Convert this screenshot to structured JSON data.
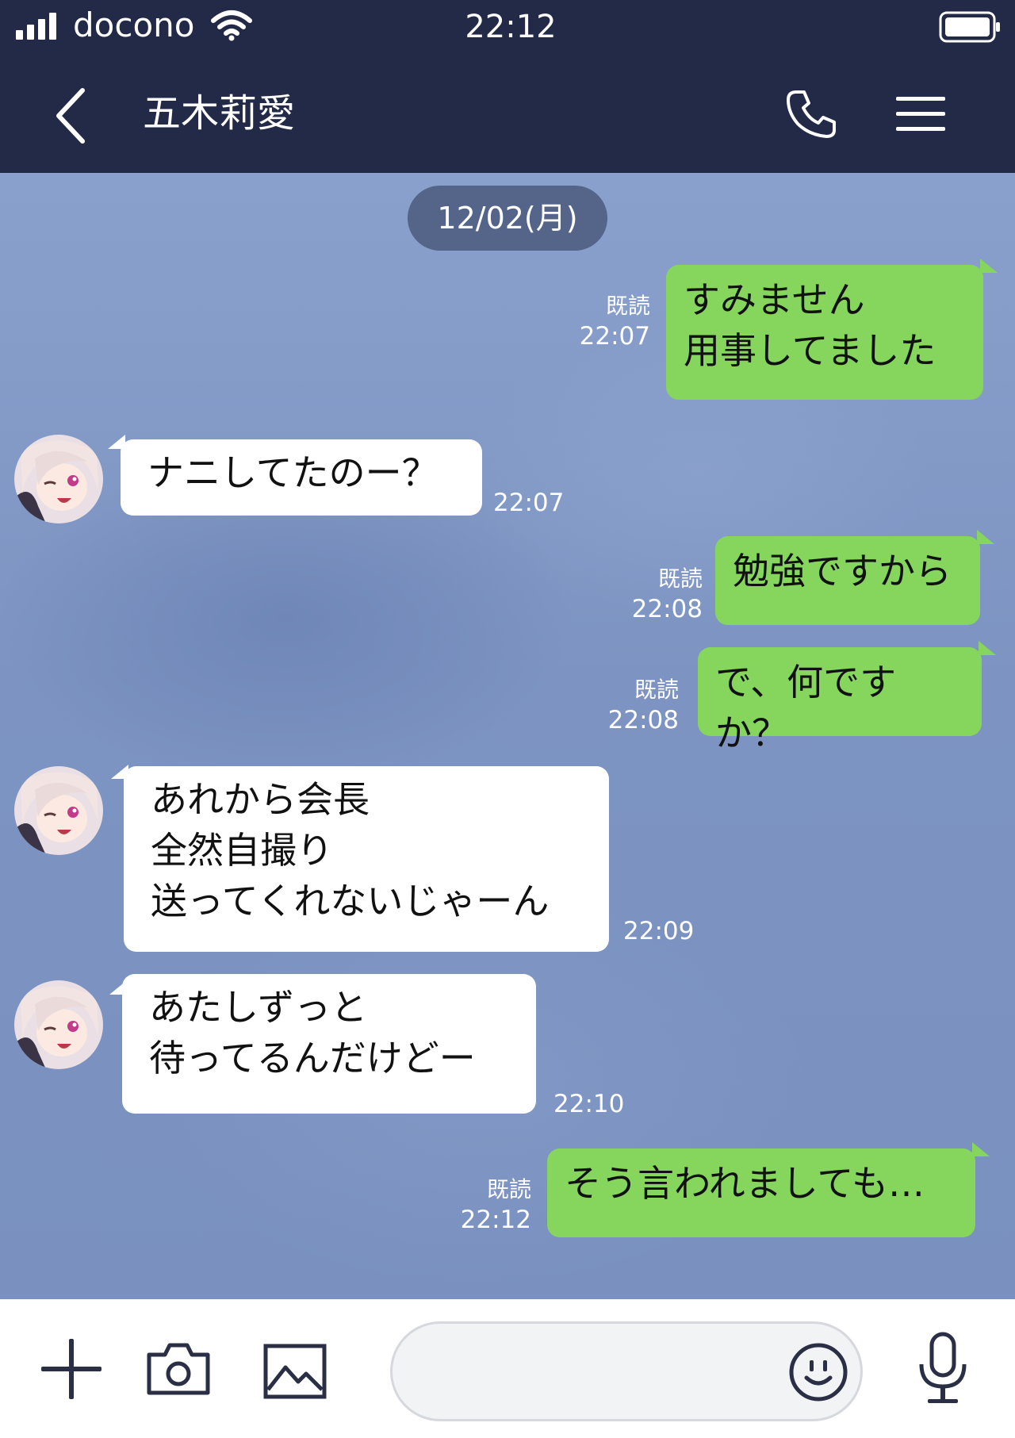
{
  "status_bar": {
    "carrier": "docono",
    "time": "22:12"
  },
  "header": {
    "contact_name": "五木莉愛",
    "icons": [
      "back-icon",
      "phone-icon",
      "menu-icon"
    ]
  },
  "chat": {
    "date_label": "12/02(月)",
    "read_label": "既読",
    "messages": [
      {
        "from": "me",
        "text": "すみません\n用事してました",
        "time": "22:07"
      },
      {
        "from": "them",
        "text": "ナニしてたのー？",
        "time": "22:07"
      },
      {
        "from": "me",
        "text": "勉強ですから",
        "time": "22:08"
      },
      {
        "from": "me",
        "text": "で、何ですか？",
        "time": "22:08"
      },
      {
        "from": "them",
        "text": "あれから会長\n全然自撮り\n送ってくれないじゃーん",
        "time": "22:09"
      },
      {
        "from": "them",
        "text": "あたしずっと\n待ってるんだけどー",
        "time": "22:10"
      },
      {
        "from": "me",
        "text": "そう言われましても…",
        "time": "22:12"
      }
    ]
  },
  "input_bar": {
    "message_value": "",
    "icons": [
      "plus-icon",
      "camera-icon",
      "image-icon",
      "emoji-icon",
      "microphone-icon"
    ]
  },
  "colors": {
    "header_bg": "#232a47",
    "chat_bg": "#7f96c3",
    "my_bubble": "#86d65e",
    "their_bubble": "#ffffff",
    "date_pill": "#546589"
  }
}
